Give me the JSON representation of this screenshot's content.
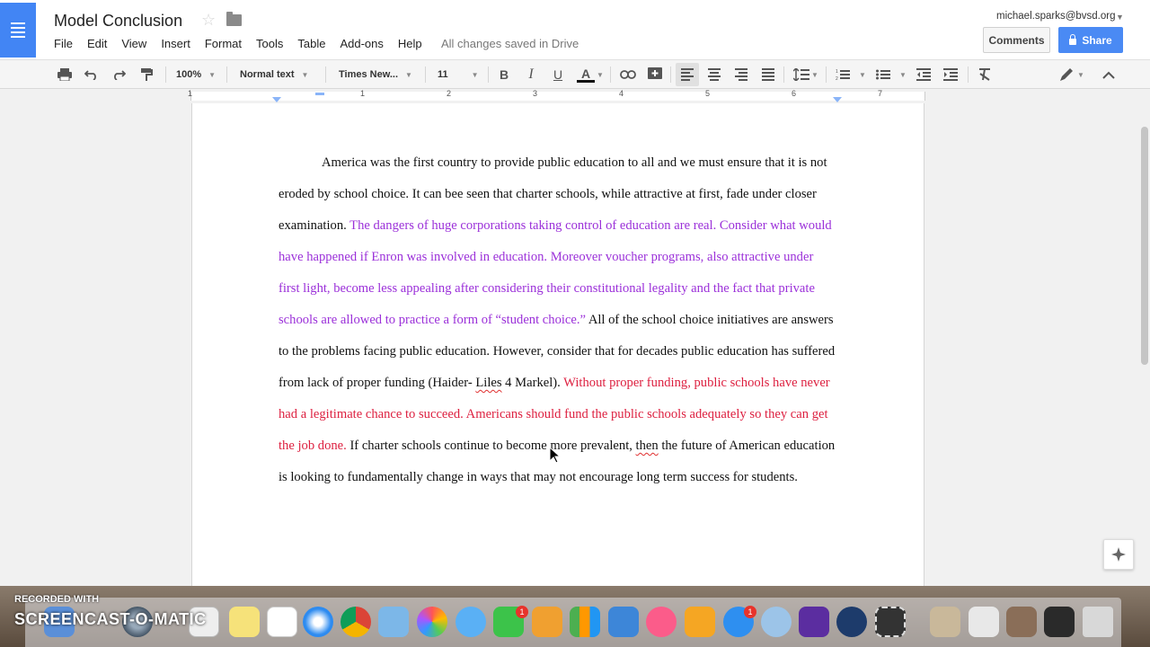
{
  "header": {
    "title": "Model Conclusion",
    "menu": [
      "File",
      "Edit",
      "View",
      "Insert",
      "Format",
      "Tools",
      "Table",
      "Add-ons",
      "Help"
    ],
    "save_status": "All changes saved in Drive",
    "account": "michael.sparks@bvsd.org",
    "comments_label": "Comments",
    "share_label": "Share"
  },
  "toolbar": {
    "zoom": "100%",
    "style": "Normal text",
    "font": "Times New...",
    "size": "11",
    "bold": "B",
    "italic": "I",
    "underline": "U",
    "text_color": "A"
  },
  "ruler": {
    "numbers": [
      "1",
      "1",
      "2",
      "3",
      "4",
      "5",
      "6",
      "7"
    ]
  },
  "document": {
    "seg1": "America was the first country to provide public education to all and we must ensure that it is not eroded by school choice. It can bee seen that charter schools, while attractive at first, fade under closer examination. ",
    "seg2_purple": "The dangers of huge corporations taking control of education are real. Consider what would have happened if Enron was involved in education. Moreover voucher programs, also attractive under first light, become less appealing after considering their constitutional legality and the fact that private schools are allowed to practice a form of “student choice.”",
    "seg3": " All of the school choice initiatives are answers to the problems facing public education. However, consider that for decades public education has suffered from lack of proper funding (Haider- ",
    "seg3_spell": "Liles",
    "seg3b": " 4 Markel). ",
    "seg4_red": "Without proper funding, public schools have never had a legitimate chance to succeed. Americans should fund the public schools adequately so they can get the job done.",
    "seg5": " If charter schools continue to become more prevalent, ",
    "seg5_spell": "then",
    "seg5b": " the future of American education is looking to fundamentally change in ways that may not encourage long term success for students."
  },
  "recording": {
    "label": "RECORDED WITH",
    "brand": "SCREENCAST-O-MATIC"
  },
  "dock": {
    "badges": [
      "1",
      "1"
    ]
  },
  "colors": {
    "purple_text": "#9b30d9",
    "red_text": "#dd1f3f",
    "share_blue": "#4a8af4",
    "docs_blue": "#4285f4"
  }
}
